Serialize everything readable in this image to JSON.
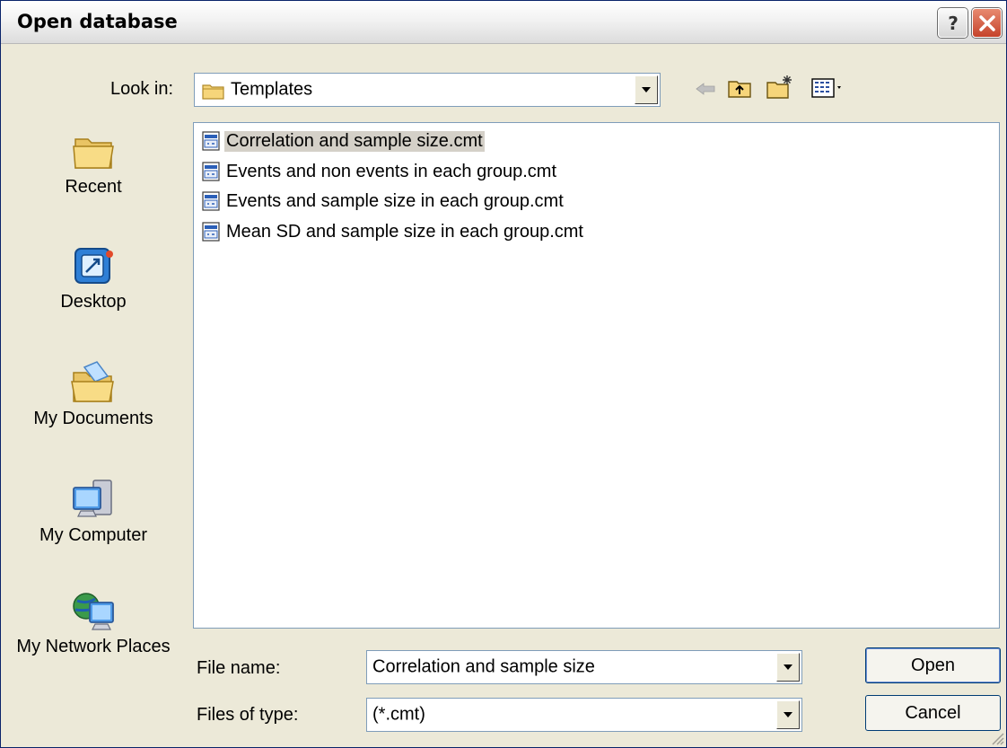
{
  "window": {
    "title": "Open database"
  },
  "look_in": {
    "label": "Look in:",
    "value": "Templates",
    "icon": "folder-icon"
  },
  "toolbar": {
    "icons": [
      "back-arrow-icon",
      "up-folder-icon",
      "new-folder-icon",
      "view-menu-icon"
    ]
  },
  "places": [
    {
      "label": "Recent",
      "icon": "recent-folder-icon"
    },
    {
      "label": "Desktop",
      "icon": "desktop-icon"
    },
    {
      "label": "My Documents",
      "icon": "my-documents-icon"
    },
    {
      "label": "My Computer",
      "icon": "my-computer-icon"
    },
    {
      "label": "My Network Places",
      "icon": "network-places-icon"
    }
  ],
  "files": [
    {
      "name": "Correlation and sample size.cmt",
      "selected": true
    },
    {
      "name": "Events and non events in each group.cmt",
      "selected": false
    },
    {
      "name": "Events and sample size in each group.cmt",
      "selected": false
    },
    {
      "name": "Mean SD and sample size in each group.cmt",
      "selected": false
    }
  ],
  "file_name": {
    "label": "File name:",
    "value": "Correlation and sample size"
  },
  "file_type": {
    "label": "Files of type:",
    "value": "(*.cmt)"
  },
  "buttons": {
    "open": "Open",
    "cancel": "Cancel"
  },
  "colors": {
    "selection": "#d4d0c8",
    "dialog_bg": "#ece9d8",
    "field_border": "#7f9db9"
  }
}
